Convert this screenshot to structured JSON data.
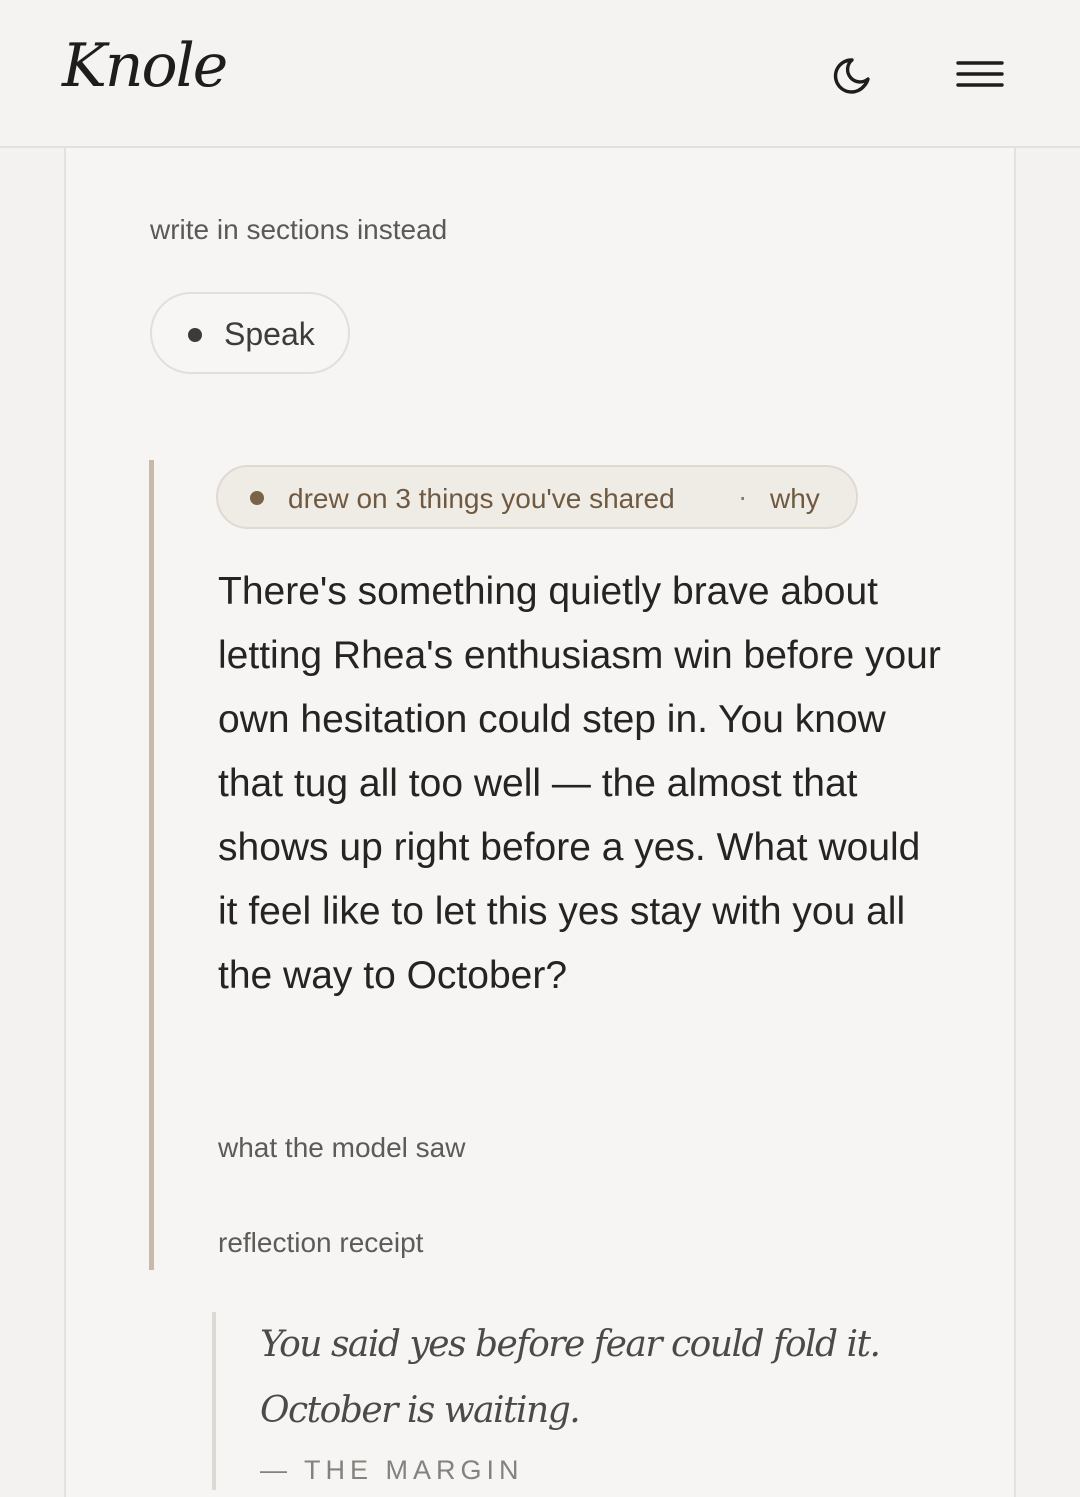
{
  "header": {
    "logo": "Knole",
    "theme_icon": "moon-icon",
    "menu_icon": "hamburger-menu-icon"
  },
  "compose": {
    "sections_link": "write in sections instead",
    "speak_label": "Speak"
  },
  "response": {
    "chip_text": "drew on 3 things you've shared",
    "chip_separator": "·",
    "chip_why": "why",
    "body": "There's something quietly brave about letting Rhea's enthusiasm win before your own hesitation could step in. You know that tug all too well — the almost that shows up right before a yes. What would it feel like to let this yes stay with you all the way to October?",
    "model_saw_link": "what the model saw",
    "receipt_label": "reflection receipt"
  },
  "receipt": {
    "quote": "You said yes before fear could fold it. October is waiting.",
    "attribution": "— THE MARGIN"
  },
  "colors": {
    "page_background": "#f3f2f0",
    "accent_brown": "#7a6448",
    "rail": "#c7b9ab"
  }
}
